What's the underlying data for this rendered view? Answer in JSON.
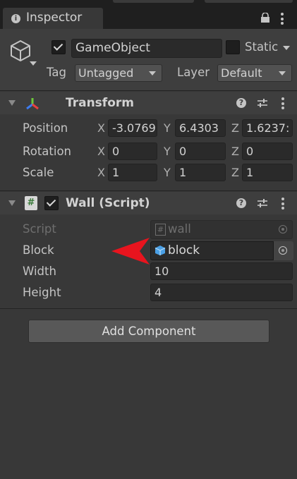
{
  "tab": {
    "title": "Inspector"
  },
  "header": {
    "name": "GameObject",
    "static_label": "Static",
    "tag_label": "Tag",
    "tag_value": "Untagged",
    "layer_label": "Layer",
    "layer_value": "Default"
  },
  "transform": {
    "title": "Transform",
    "rows": [
      {
        "label": "Position",
        "x": "-3.0769",
        "y": "6.4303",
        "z": "1.6237:"
      },
      {
        "label": "Rotation",
        "x": "0",
        "y": "0",
        "z": "0"
      },
      {
        "label": "Scale",
        "x": "1",
        "y": "1",
        "z": "1"
      }
    ],
    "axes": {
      "x": "X",
      "y": "Y",
      "z": "Z"
    }
  },
  "wall": {
    "title": "Wall (Script)",
    "script_label": "Script",
    "script_value": "wall",
    "block_label": "Block",
    "block_value": "block",
    "width_label": "Width",
    "width_value": "10",
    "height_label": "Height",
    "height_value": "4"
  },
  "add_component": "Add Component",
  "colors": {
    "arrow": "#e8141e",
    "background": "#383838",
    "section_header": "#3e3e3e"
  }
}
